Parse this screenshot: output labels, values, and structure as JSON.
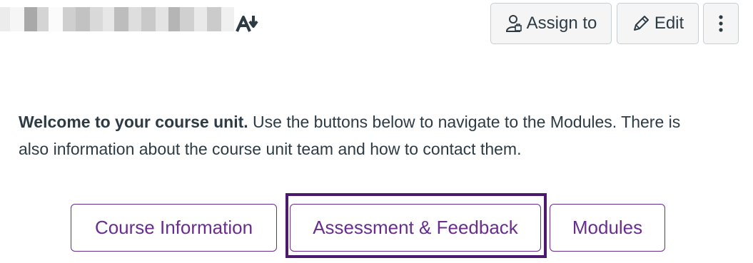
{
  "toolbar": {
    "assign_label": "Assign to",
    "edit_label": "Edit",
    "assign_icon": "assign-user-icon",
    "edit_icon": "pencil-icon",
    "more_icon": "more-vertical-icon",
    "reader_icon": "immersive-reader-icon"
  },
  "content": {
    "welcome_bold": "Welcome to your course unit.",
    "welcome_text": " Use the buttons below to navigate to the Modules. There is also information about the course unit team and how to contact them."
  },
  "nav_buttons": {
    "course_information": "Course Information",
    "assessment_feedback": "Assessment & Feedback",
    "modules": "Modules"
  },
  "colors": {
    "accent": "#6a2c8f",
    "highlight": "#4b1a6e",
    "text": "#2d3b45"
  }
}
